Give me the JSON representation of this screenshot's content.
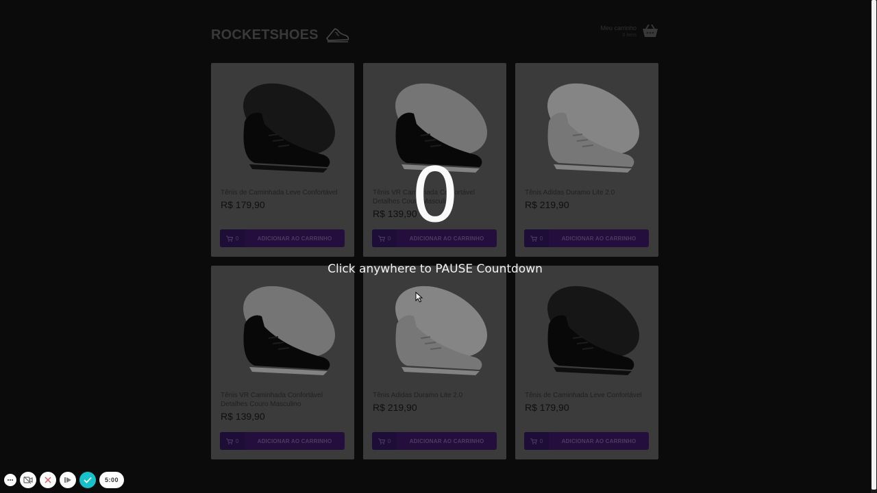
{
  "header": {
    "logo_text": "ROCKETSHOES",
    "cart_title": "Meu carrinho",
    "cart_count": "0 itens"
  },
  "products": [
    {
      "title": "Tênis de Caminhada Leve Confortável",
      "price": "R$ 179,90",
      "qty": "0",
      "button": "ADICIONAR AO CARRINHO",
      "shoe_color": "dark"
    },
    {
      "title": "Tênis VR Caminhada Confortável Detalhes Couro Masculino",
      "price": "R$ 139,90",
      "qty": "0",
      "button": "ADICIONAR AO CARRINHO",
      "shoe_color": "dark-white"
    },
    {
      "title": "Tênis Adidas Duramo Lite 2.0",
      "price": "R$ 219,90",
      "qty": "0",
      "button": "ADICIONAR AO CARRINHO",
      "shoe_color": "light"
    },
    {
      "title": "Tênis VR Caminhada Confortável Detalhes Couro Masculino",
      "price": "R$ 139,90",
      "qty": "0",
      "button": "ADICIONAR AO CARRINHO",
      "shoe_color": "dark-white"
    },
    {
      "title": "Tênis Adidas Duramo Lite 2.0",
      "price": "R$ 219,90",
      "qty": "0",
      "button": "ADICIONAR AO CARRINHO",
      "shoe_color": "light"
    },
    {
      "title": "Tênis de Caminhada Leve Confortável",
      "price": "R$ 179,90",
      "qty": "0",
      "button": "ADICIONAR AO CARRINHO",
      "shoe_color": "dark"
    }
  ],
  "overlay": {
    "countdown": "0",
    "hint": "Click anywhere to PAUSE Countdown"
  },
  "toolbar": {
    "timer": "5:00"
  },
  "colors": {
    "button": "#2b1148",
    "card": "#464646",
    "done": "#16c1c9"
  }
}
